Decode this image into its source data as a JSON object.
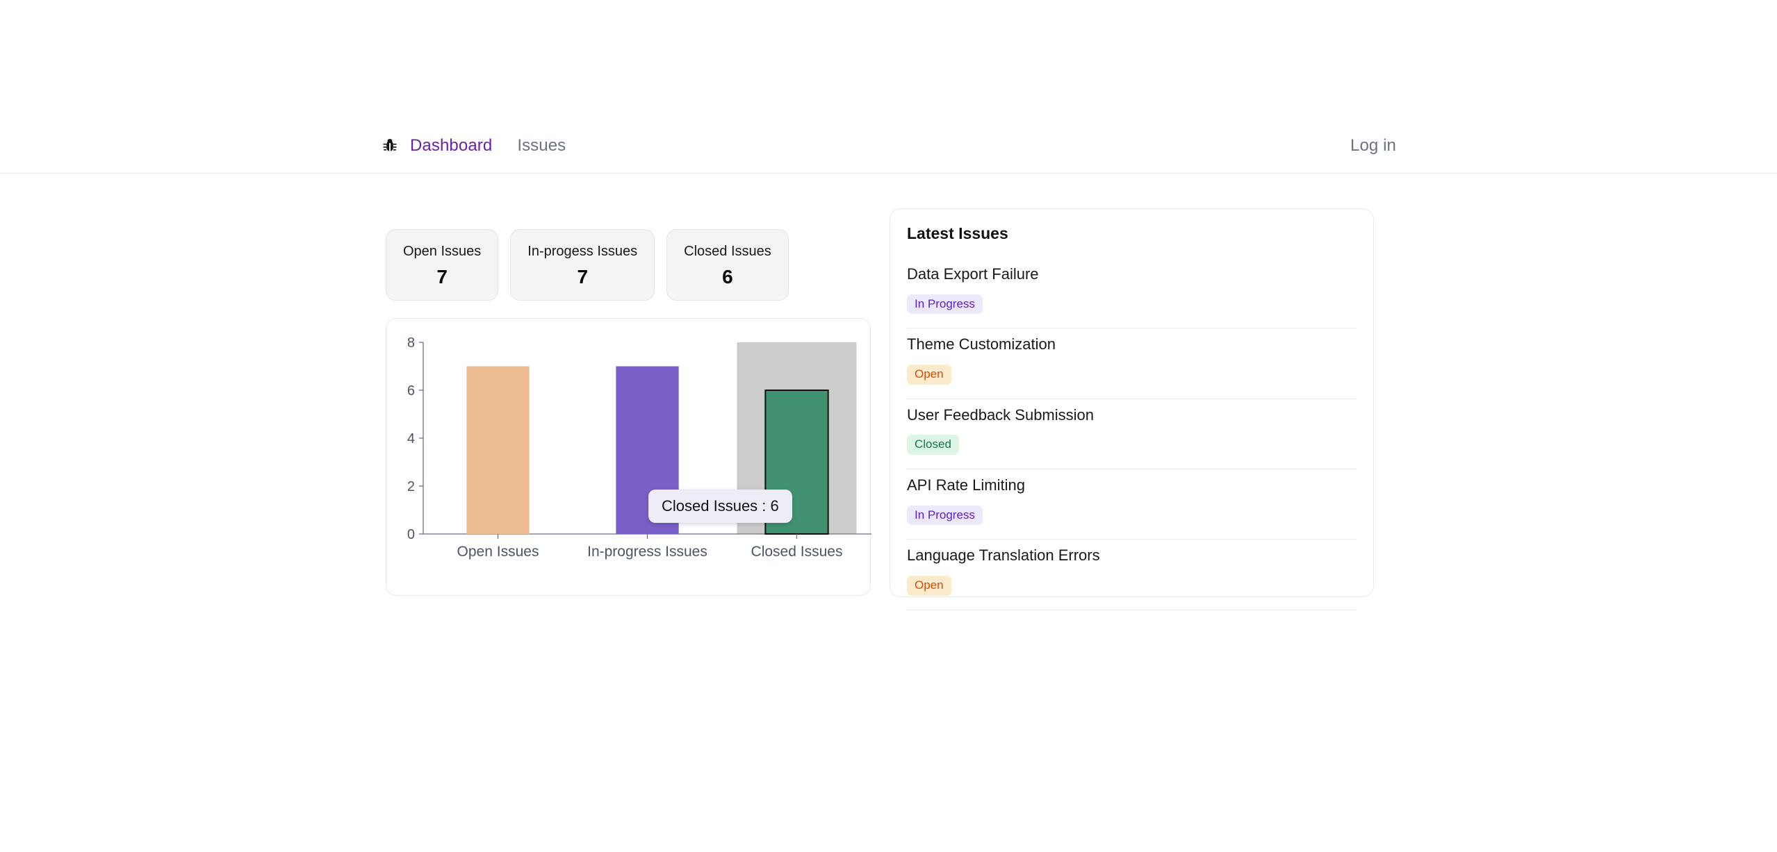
{
  "nav": {
    "logo_icon": "bug-icon",
    "items": [
      {
        "label": "Dashboard",
        "active": true
      },
      {
        "label": "Issues",
        "active": false
      }
    ],
    "login_label": "Log in"
  },
  "stats": [
    {
      "label": "Open Issues",
      "value": "7"
    },
    {
      "label": "In-progess Issues",
      "value": "7"
    },
    {
      "label": "Closed Issues",
      "value": "6"
    }
  ],
  "chart_data": {
    "type": "bar",
    "title": "",
    "xlabel": "",
    "ylabel": "",
    "categories": [
      "Open Issues",
      "In-progress Issues",
      "Closed Issues"
    ],
    "values": [
      7,
      7,
      6
    ],
    "colors": [
      "#eebd93",
      "#7a5fc6",
      "#409272"
    ],
    "ylim": [
      0,
      8
    ],
    "yticks": [
      0,
      2,
      4,
      6,
      8
    ],
    "ytick_labels": [
      "0",
      "2",
      "4",
      "6",
      "8"
    ],
    "grid": false,
    "legend": "none",
    "hovered_category": "Closed Issues",
    "hover_band_color": "#cccccc",
    "active_bar_stroke": "#111111",
    "tooltip": "Closed Issues : 6"
  },
  "issues_panel": {
    "title": "Latest Issues",
    "rows": [
      {
        "title": "Data Export Failure",
        "status": "In Progress",
        "status_class": "inprogress"
      },
      {
        "title": "Theme Customization",
        "status": "Open",
        "status_class": "open"
      },
      {
        "title": "User Feedback Submission",
        "status": "Closed",
        "status_class": "closed"
      },
      {
        "title": "API Rate Limiting",
        "status": "In Progress",
        "status_class": "inprogress"
      },
      {
        "title": "Language Translation Errors",
        "status": "Open",
        "status_class": "open"
      }
    ]
  },
  "theme": {
    "accent": "#6b21a8",
    "muted_text": "#6b7280",
    "card_bg": "#f4f4f5",
    "border": "#e9e9ec"
  }
}
